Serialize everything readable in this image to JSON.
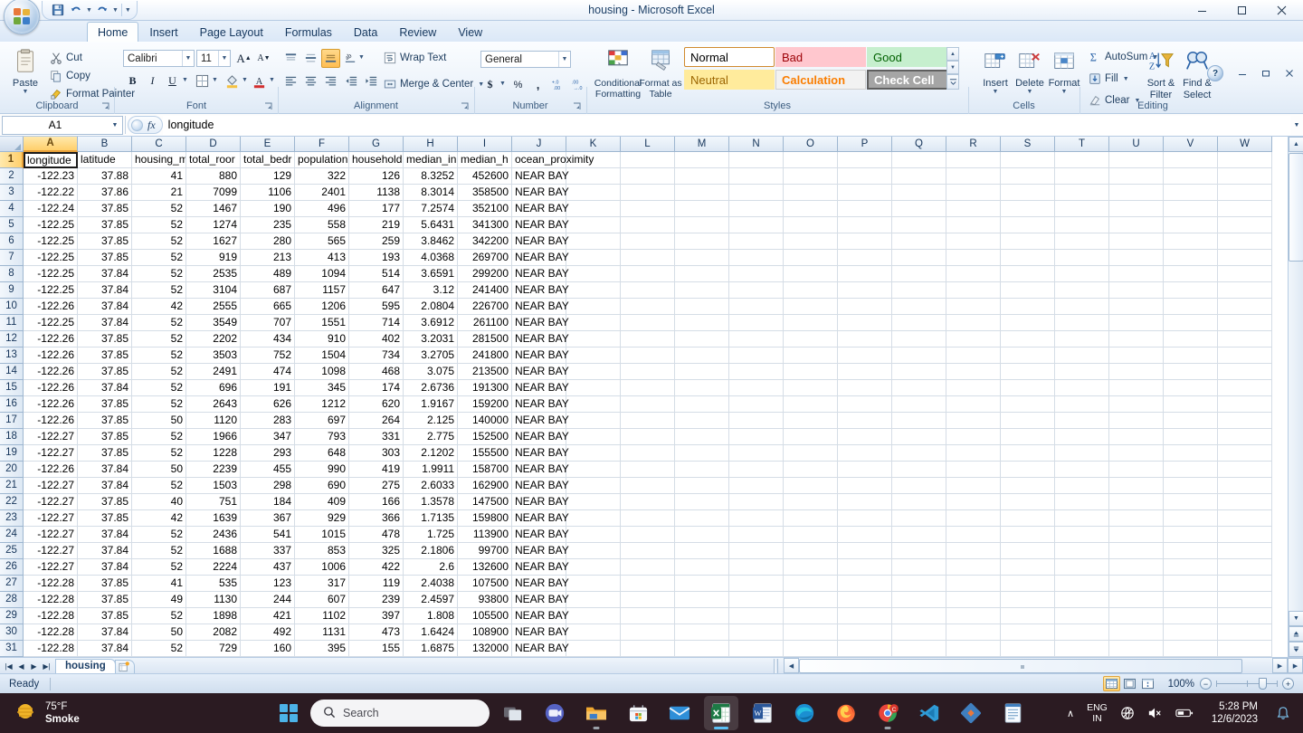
{
  "window": {
    "title": "housing - Microsoft Excel",
    "minimize": "—",
    "restore": "❐",
    "close": "✕",
    "inner_minimize": "—",
    "inner_restore": "❐",
    "inner_close": "✕",
    "help_label": "?"
  },
  "qat": {
    "items": [
      {
        "name": "save-button",
        "label": "Save"
      },
      {
        "name": "undo-button",
        "label": "Undo"
      },
      {
        "name": "redo-button",
        "label": "Redo"
      },
      {
        "name": "customize-qat-button",
        "label": "Customize Quick Access Toolbar"
      }
    ]
  },
  "tabs": [
    {
      "label": "Home",
      "active": true
    },
    {
      "label": "Insert",
      "active": false
    },
    {
      "label": "Page Layout",
      "active": false
    },
    {
      "label": "Formulas",
      "active": false
    },
    {
      "label": "Data",
      "active": false
    },
    {
      "label": "Review",
      "active": false
    },
    {
      "label": "View",
      "active": false
    }
  ],
  "ribbon": {
    "groups": [
      {
        "label": "Clipboard"
      },
      {
        "label": "Font"
      },
      {
        "label": "Alignment"
      },
      {
        "label": "Number"
      },
      {
        "label": "Styles"
      },
      {
        "label": "Cells"
      },
      {
        "label": "Editing"
      }
    ],
    "clipboard": {
      "paste": "Paste",
      "cut": "Cut",
      "copy": "Copy",
      "format_painter": "Format Painter"
    },
    "font": {
      "font_name": "Calibri",
      "font_size": "11",
      "grow_font": "A",
      "shrink_font": "A",
      "bold": "B",
      "italic": "I",
      "underline": "U",
      "borders": "Borders",
      "fill_color": "Fill Color",
      "font_color": "A"
    },
    "alignment": {
      "wrap_text": "Wrap Text",
      "merge_center": "Merge & Center",
      "top_align": "Top Align",
      "middle_align": "Middle Align",
      "bottom_align": "Bottom Align",
      "orientation": "Orientation",
      "align_left": "Align Text Left",
      "align_center": "Center",
      "align_right": "Align Text Right",
      "decrease_indent": "Decrease Indent",
      "increase_indent": "Increase Indent"
    },
    "number": {
      "format": "General",
      "accounting": "$",
      "percent": "%",
      "comma": ",",
      "increase_decimal": "Increase Decimal",
      "decrease_decimal": "Decrease Decimal"
    },
    "styles": {
      "conditional_formatting": "Conditional Formatting",
      "format_as_table": "Format as Table",
      "cell_styles": [
        {
          "label": "Normal",
          "bg": "#ffffff",
          "fg": "#000000",
          "border": "#d08a2e",
          "selected": true
        },
        {
          "label": "Bad",
          "bg": "#ffc7ce",
          "fg": "#9c0006",
          "border": "#ffc7ce",
          "selected": false
        },
        {
          "label": "Good",
          "bg": "#c6efce",
          "fg": "#006100",
          "border": "#c6efce",
          "selected": false
        },
        {
          "label": "Neutral",
          "bg": "#ffeb9c",
          "fg": "#9c6500",
          "border": "#ffeb9c",
          "selected": false
        },
        {
          "label": "Calculation",
          "bg": "#f2f2f2",
          "fg": "#fa7d00",
          "border": "#d0d0d0",
          "selected": false
        },
        {
          "label": "Check Cell",
          "bg": "#a5a5a5",
          "fg": "#ffffff",
          "border": "#666666",
          "selected": false
        }
      ]
    },
    "cells": {
      "insert": "Insert",
      "delete": "Delete",
      "format": "Format"
    },
    "editing": {
      "autosum": "AutoSum",
      "fill": "Fill",
      "clear": "Clear",
      "sort_filter": "Sort &\nFilter",
      "sort_filter_l1": "Sort &",
      "sort_filter_l2": "Filter",
      "find_select_l1": "Find &",
      "find_select_l2": "Select"
    }
  },
  "formula_bar": {
    "name_box": "A1",
    "formula": "longitude",
    "fx_label": "fx"
  },
  "grid": {
    "columns": [
      "A",
      "B",
      "C",
      "D",
      "E",
      "F",
      "G",
      "H",
      "I",
      "J",
      "K",
      "L",
      "M",
      "N",
      "O",
      "P",
      "Q",
      "R",
      "S",
      "T",
      "U",
      "V",
      "W"
    ],
    "selected_column": "A",
    "selected_row": 1,
    "active_cell": "A1",
    "header_row": [
      "longitude",
      "latitude",
      "housing_m",
      "total_roor",
      "total_bedr",
      "population",
      "household",
      "median_in",
      "median_h",
      "ocean_proximity"
    ],
    "header_full": [
      "longitude",
      "latitude",
      "housing_median_age",
      "total_rooms",
      "total_bedrooms",
      "population",
      "households",
      "median_income",
      "median_house_value",
      "ocean_proximity"
    ],
    "rows": [
      {
        "n": 2,
        "v": [
          "-122.23",
          "37.88",
          "41",
          "880",
          "129",
          "322",
          "126",
          "8.3252",
          "452600",
          "NEAR BAY"
        ]
      },
      {
        "n": 3,
        "v": [
          "-122.22",
          "37.86",
          "21",
          "7099",
          "1106",
          "2401",
          "1138",
          "8.3014",
          "358500",
          "NEAR BAY"
        ]
      },
      {
        "n": 4,
        "v": [
          "-122.24",
          "37.85",
          "52",
          "1467",
          "190",
          "496",
          "177",
          "7.2574",
          "352100",
          "NEAR BAY"
        ]
      },
      {
        "n": 5,
        "v": [
          "-122.25",
          "37.85",
          "52",
          "1274",
          "235",
          "558",
          "219",
          "5.6431",
          "341300",
          "NEAR BAY"
        ]
      },
      {
        "n": 6,
        "v": [
          "-122.25",
          "37.85",
          "52",
          "1627",
          "280",
          "565",
          "259",
          "3.8462",
          "342200",
          "NEAR BAY"
        ]
      },
      {
        "n": 7,
        "v": [
          "-122.25",
          "37.85",
          "52",
          "919",
          "213",
          "413",
          "193",
          "4.0368",
          "269700",
          "NEAR BAY"
        ]
      },
      {
        "n": 8,
        "v": [
          "-122.25",
          "37.84",
          "52",
          "2535",
          "489",
          "1094",
          "514",
          "3.6591",
          "299200",
          "NEAR BAY"
        ]
      },
      {
        "n": 9,
        "v": [
          "-122.25",
          "37.84",
          "52",
          "3104",
          "687",
          "1157",
          "647",
          "3.12",
          "241400",
          "NEAR BAY"
        ]
      },
      {
        "n": 10,
        "v": [
          "-122.26",
          "37.84",
          "42",
          "2555",
          "665",
          "1206",
          "595",
          "2.0804",
          "226700",
          "NEAR BAY"
        ]
      },
      {
        "n": 11,
        "v": [
          "-122.25",
          "37.84",
          "52",
          "3549",
          "707",
          "1551",
          "714",
          "3.6912",
          "261100",
          "NEAR BAY"
        ]
      },
      {
        "n": 12,
        "v": [
          "-122.26",
          "37.85",
          "52",
          "2202",
          "434",
          "910",
          "402",
          "3.2031",
          "281500",
          "NEAR BAY"
        ]
      },
      {
        "n": 13,
        "v": [
          "-122.26",
          "37.85",
          "52",
          "3503",
          "752",
          "1504",
          "734",
          "3.2705",
          "241800",
          "NEAR BAY"
        ]
      },
      {
        "n": 14,
        "v": [
          "-122.26",
          "37.85",
          "52",
          "2491",
          "474",
          "1098",
          "468",
          "3.075",
          "213500",
          "NEAR BAY"
        ]
      },
      {
        "n": 15,
        "v": [
          "-122.26",
          "37.84",
          "52",
          "696",
          "191",
          "345",
          "174",
          "2.6736",
          "191300",
          "NEAR BAY"
        ]
      },
      {
        "n": 16,
        "v": [
          "-122.26",
          "37.85",
          "52",
          "2643",
          "626",
          "1212",
          "620",
          "1.9167",
          "159200",
          "NEAR BAY"
        ]
      },
      {
        "n": 17,
        "v": [
          "-122.26",
          "37.85",
          "50",
          "1120",
          "283",
          "697",
          "264",
          "2.125",
          "140000",
          "NEAR BAY"
        ]
      },
      {
        "n": 18,
        "v": [
          "-122.27",
          "37.85",
          "52",
          "1966",
          "347",
          "793",
          "331",
          "2.775",
          "152500",
          "NEAR BAY"
        ]
      },
      {
        "n": 19,
        "v": [
          "-122.27",
          "37.85",
          "52",
          "1228",
          "293",
          "648",
          "303",
          "2.1202",
          "155500",
          "NEAR BAY"
        ]
      },
      {
        "n": 20,
        "v": [
          "-122.26",
          "37.84",
          "50",
          "2239",
          "455",
          "990",
          "419",
          "1.9911",
          "158700",
          "NEAR BAY"
        ]
      },
      {
        "n": 21,
        "v": [
          "-122.27",
          "37.84",
          "52",
          "1503",
          "298",
          "690",
          "275",
          "2.6033",
          "162900",
          "NEAR BAY"
        ]
      },
      {
        "n": 22,
        "v": [
          "-122.27",
          "37.85",
          "40",
          "751",
          "184",
          "409",
          "166",
          "1.3578",
          "147500",
          "NEAR BAY"
        ]
      },
      {
        "n": 23,
        "v": [
          "-122.27",
          "37.85",
          "42",
          "1639",
          "367",
          "929",
          "366",
          "1.7135",
          "159800",
          "NEAR BAY"
        ]
      },
      {
        "n": 24,
        "v": [
          "-122.27",
          "37.84",
          "52",
          "2436",
          "541",
          "1015",
          "478",
          "1.725",
          "113900",
          "NEAR BAY"
        ]
      },
      {
        "n": 25,
        "v": [
          "-122.27",
          "37.84",
          "52",
          "1688",
          "337",
          "853",
          "325",
          "2.1806",
          "99700",
          "NEAR BAY"
        ]
      },
      {
        "n": 26,
        "v": [
          "-122.27",
          "37.84",
          "52",
          "2224",
          "437",
          "1006",
          "422",
          "2.6",
          "132600",
          "NEAR BAY"
        ]
      },
      {
        "n": 27,
        "v": [
          "-122.28",
          "37.85",
          "41",
          "535",
          "123",
          "317",
          "119",
          "2.4038",
          "107500",
          "NEAR BAY"
        ]
      },
      {
        "n": 28,
        "v": [
          "-122.28",
          "37.85",
          "49",
          "1130",
          "244",
          "607",
          "239",
          "2.4597",
          "93800",
          "NEAR BAY"
        ]
      },
      {
        "n": 29,
        "v": [
          "-122.28",
          "37.85",
          "52",
          "1898",
          "421",
          "1102",
          "397",
          "1.808",
          "105500",
          "NEAR BAY"
        ]
      },
      {
        "n": 30,
        "v": [
          "-122.28",
          "37.84",
          "50",
          "2082",
          "492",
          "1131",
          "473",
          "1.6424",
          "108900",
          "NEAR BAY"
        ]
      },
      {
        "n": 31,
        "v": [
          "-122.28",
          "37.84",
          "52",
          "729",
          "160",
          "395",
          "155",
          "1.6875",
          "132000",
          "NEAR BAY"
        ]
      }
    ]
  },
  "sheet_tabs": {
    "tabs": [
      {
        "label": "housing",
        "active": true
      }
    ],
    "insert_sheet": "Insert Worksheet"
  },
  "status_bar": {
    "status": "Ready",
    "zoom": "100%",
    "views": [
      {
        "name": "normal-view-button",
        "on": true
      },
      {
        "name": "page-layout-view-button",
        "on": false
      },
      {
        "name": "page-break-preview-button",
        "on": false
      }
    ],
    "zoom_out": "−",
    "zoom_in": "+"
  },
  "taskbar": {
    "weather_temp": "75°F",
    "weather_cond": "Smoke",
    "search_placeholder": "Search",
    "apps": [
      {
        "name": "task-view-button",
        "state": "idle"
      },
      {
        "name": "teams-icon",
        "state": "idle"
      },
      {
        "name": "file-explorer-icon",
        "state": "running"
      },
      {
        "name": "microsoft-store-icon",
        "state": "idle"
      },
      {
        "name": "mail-icon",
        "state": "idle"
      },
      {
        "name": "excel-icon",
        "state": "active"
      },
      {
        "name": "word-icon",
        "state": "idle"
      },
      {
        "name": "edge-icon",
        "state": "idle"
      },
      {
        "name": "firefox-icon",
        "state": "idle"
      },
      {
        "name": "chrome-icon",
        "state": "running"
      },
      {
        "name": "vscode-icon",
        "state": "idle"
      },
      {
        "name": "diamond-app-icon",
        "state": "idle"
      },
      {
        "name": "notepad-icon",
        "state": "idle"
      }
    ],
    "tray": {
      "show_hidden": "∧",
      "lang_l1": "ENG",
      "lang_l2": "IN",
      "time": "5:28 PM",
      "date": "12/6/2023"
    }
  }
}
